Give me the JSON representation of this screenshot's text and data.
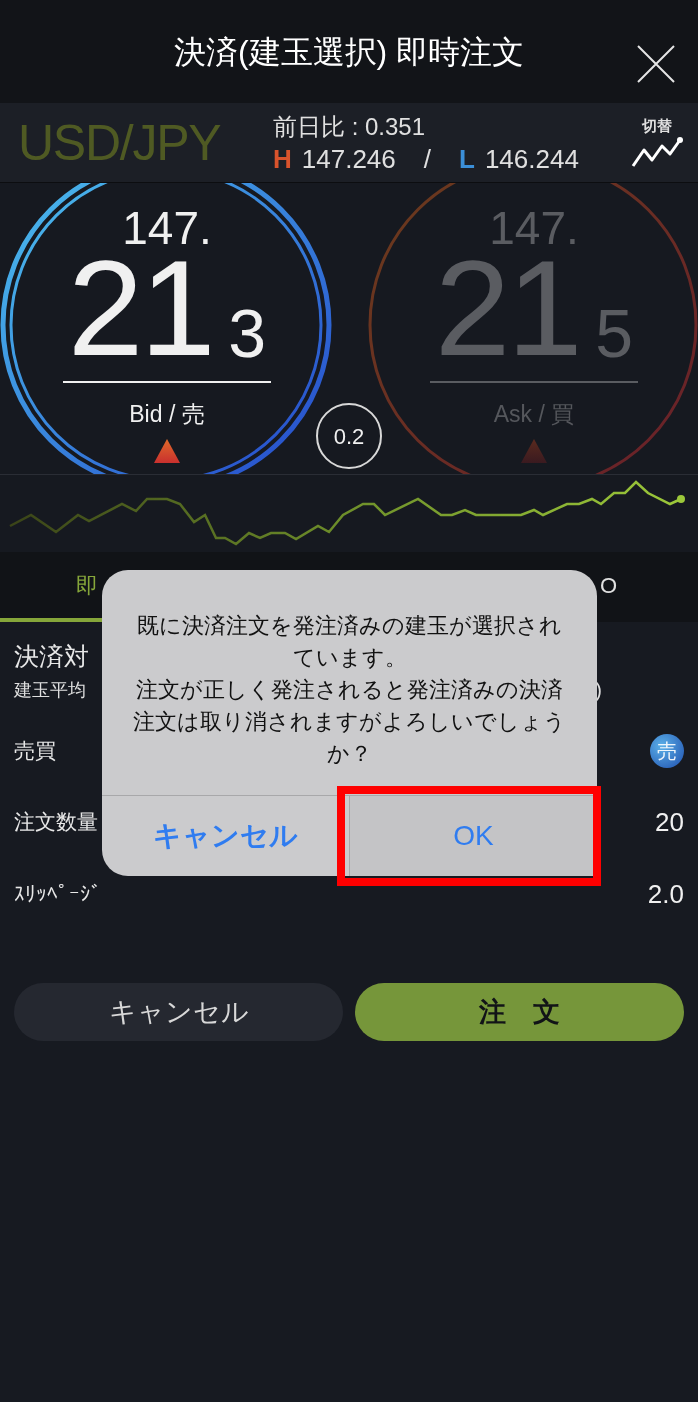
{
  "header": {
    "title": "決済(建玉選択) 即時注文"
  },
  "instrument": {
    "pair": "USD/JPY",
    "change": "前日比 : 0.351",
    "high_label": "H",
    "high": "147.246",
    "separator": "/",
    "low_label": "L",
    "low": "146.244",
    "switch_label": "切替"
  },
  "prices": [
    {
      "kind": "bid",
      "head": "147.",
      "main": "21",
      "pip": "3",
      "label": "Bid / 売",
      "active": true
    },
    {
      "kind": "ask",
      "head": "147.",
      "main": "21",
      "pip": "5",
      "label": "Ask / 買",
      "active": false
    }
  ],
  "spread": "0.2",
  "tabs": [
    {
      "label": "即",
      "selected": true
    },
    {
      "label": "O",
      "selected": false
    }
  ],
  "rows": [
    {
      "kind": "title",
      "label": "決済対"
    },
    {
      "kind": "sub",
      "label": "建玉平均",
      "value": ")"
    },
    {
      "kind": "badge",
      "label": "売買",
      "value": "売"
    },
    {
      "kind": "value",
      "label": "注文数量",
      "value": "20"
    },
    {
      "kind": "value",
      "label": "ｽﾘｯﾍﾟｰｼﾞ",
      "value": "2.0"
    }
  ],
  "buttons": [
    {
      "kind": "secondary",
      "label": "キャンセル"
    },
    {
      "kind": "primary",
      "label": "注　文"
    }
  ],
  "dialog": {
    "message": [
      "既に決済注文を発注済みの建玉が選択されています。",
      "注文が正しく発注されると発注済みの決済注文は取り消されますがよろしいでしょうか？"
    ],
    "buttons": [
      {
        "kind": "cancel",
        "label": "キャンセル",
        "highlighted": false
      },
      {
        "kind": "default",
        "label": "OK",
        "highlighted": true
      }
    ]
  }
}
